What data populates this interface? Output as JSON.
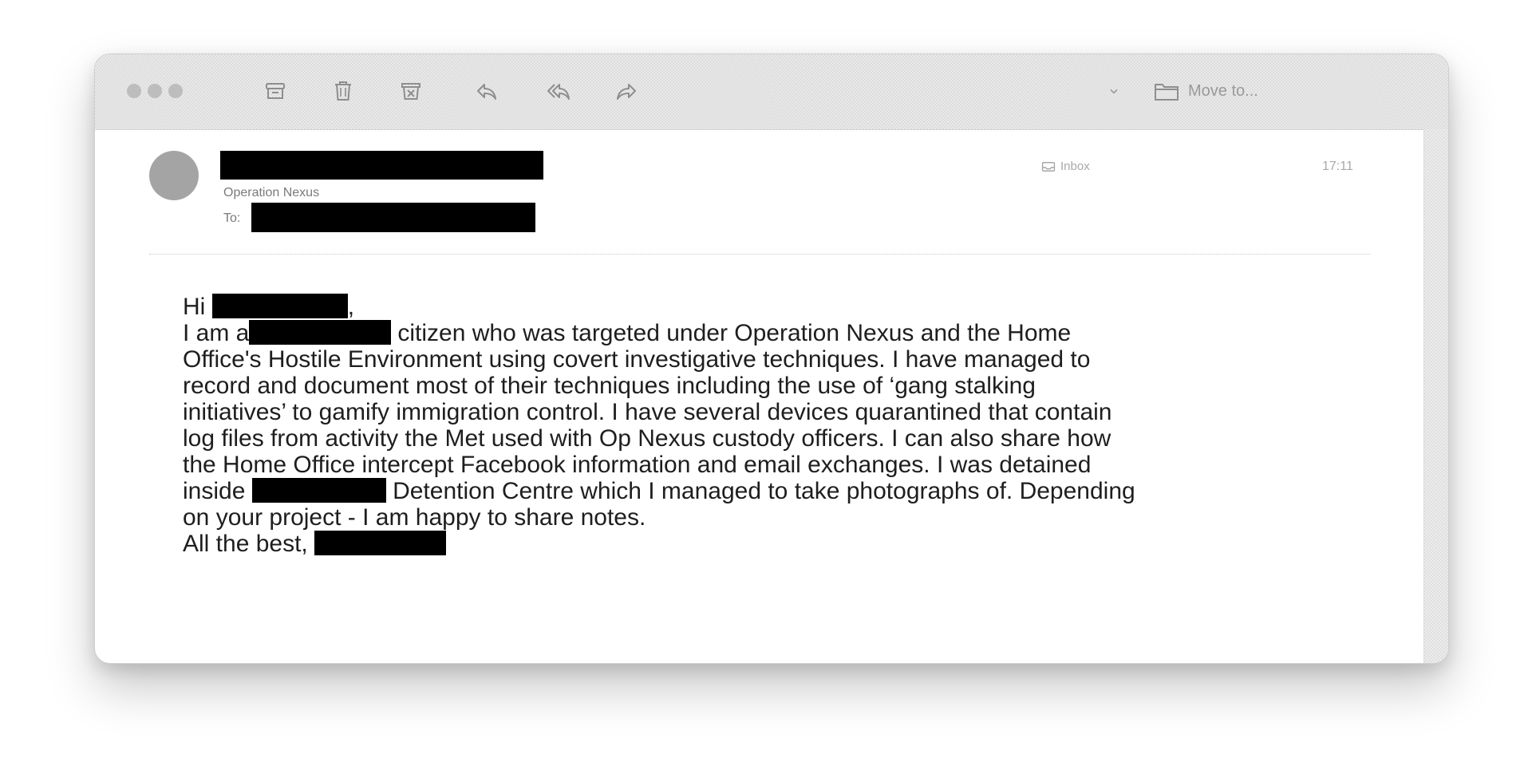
{
  "toolbar": {
    "icons": [
      "archive-icon",
      "trash-icon",
      "junk-icon",
      "reply-icon",
      "reply-all-icon",
      "forward-icon",
      "chevron-down-icon",
      "folder-icon"
    ],
    "move_label": "Move to..."
  },
  "message": {
    "sender_org": "Operation Nexus",
    "to_label": "To:",
    "mailbox": "Inbox",
    "time": "17:11"
  },
  "body": {
    "greeting_prefix": "Hi",
    "greeting_suffix": ",",
    "line1_prefix": "I am a",
    "line1_suffix": "citizen who was targeted under Operation Nexus and the Home",
    "line2": "Office's Hostile Environment using covert investigative techniques. I have managed to",
    "line3": "record and document most of their techniques including the use of ‘gang stalking",
    "line4": "initiatives’ to gamify immigration control. I have several devices quarantined that contain",
    "line5": "log files from activity the Met used with Op Nexus custody officers. I can also share how",
    "line6": "the Home Office intercept Facebook information and email exchanges. I was detained",
    "line7_prefix": "inside",
    "line7_suffix": "Detention Centre which I managed to take photographs of. Depending",
    "line8": "on your project - I am happy to share notes.",
    "signoff": "All the best,"
  },
  "colors": {
    "redaction": "#000000",
    "window_bg": "#ffffff",
    "toolbar_bg": "#e9e9e9",
    "body_text": "#1e1e1e"
  }
}
